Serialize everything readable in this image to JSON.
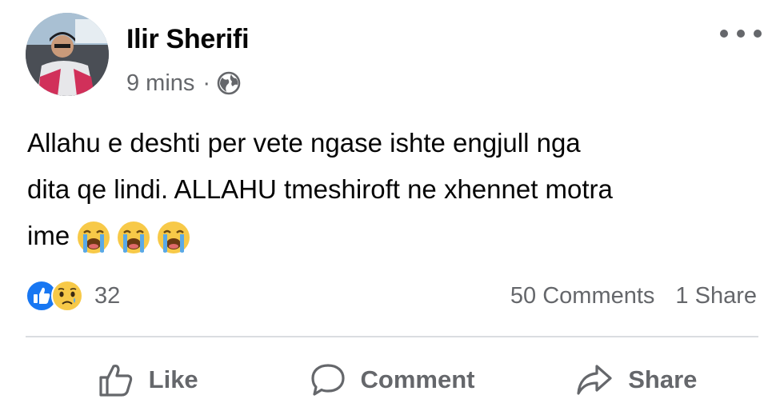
{
  "post": {
    "author": "Ilir Sherifi",
    "timestamp": "9 mins",
    "separator": "·",
    "privacy_icon": "globe-icon",
    "more_icon": "more-options-icon",
    "text_line1": "Allahu e deshti per vete ngase ishte engjull nga",
    "text_line2": "dita qe lindi. ALLAHU tmeshiroft ne xhennet motra",
    "text_line3": "ime",
    "emoji": [
      "loudly-crying-face-emoji",
      "loudly-crying-face-emoji",
      "loudly-crying-face-emoji"
    ]
  },
  "reactions": {
    "icons": [
      "like-reaction-icon",
      "sad-reaction-icon"
    ],
    "count": "32",
    "comments": "50 Comments",
    "shares": "1 Share"
  },
  "actions": [
    {
      "label": "Like",
      "icon": "thumbs-up-icon"
    },
    {
      "label": "Comment",
      "icon": "comment-bubble-icon"
    },
    {
      "label": "Share",
      "icon": "share-arrow-icon"
    }
  ],
  "colors": {
    "primary_text": "#050505",
    "secondary_text": "#65676b",
    "like_blue": "#1877f2",
    "divider": "#dadde1"
  }
}
